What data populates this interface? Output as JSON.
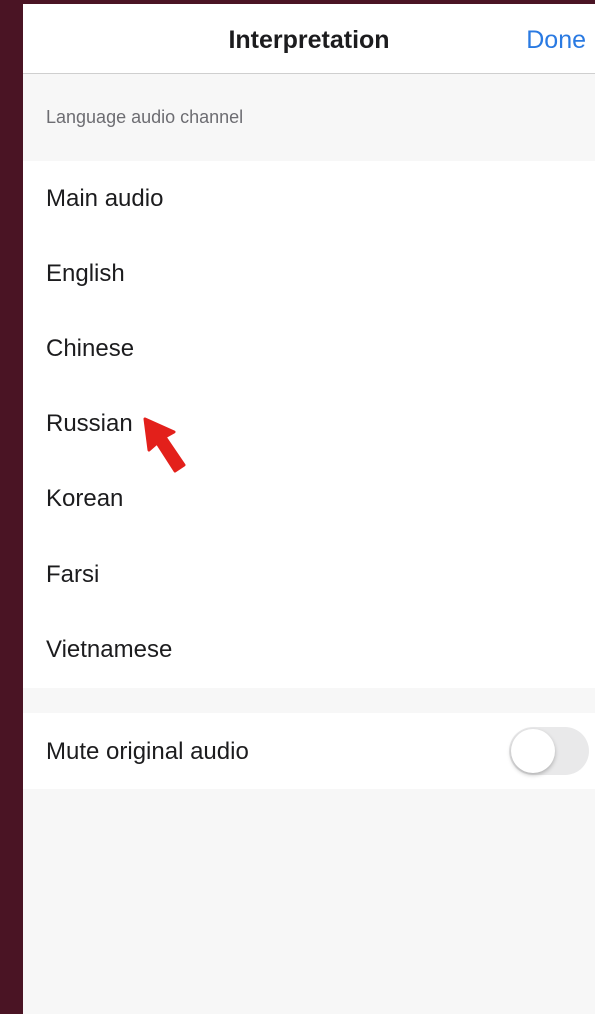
{
  "header": {
    "title": "Interpretation",
    "done_label": "Done"
  },
  "section": {
    "header": "Language audio channel"
  },
  "languages": [
    {
      "label": "Main audio"
    },
    {
      "label": "English"
    },
    {
      "label": "Chinese"
    },
    {
      "label": "Russian"
    },
    {
      "label": "Korean"
    },
    {
      "label": "Farsi"
    },
    {
      "label": "Vietnamese"
    }
  ],
  "mute": {
    "label": "Mute original audio",
    "enabled": false
  },
  "colors": {
    "accent": "#2a7ae2",
    "annotation_arrow": "#e3201b",
    "outer_background": "#4a1424"
  },
  "annotation": {
    "icon": "red-pointer-arrow-icon",
    "points_to": "Russian"
  }
}
